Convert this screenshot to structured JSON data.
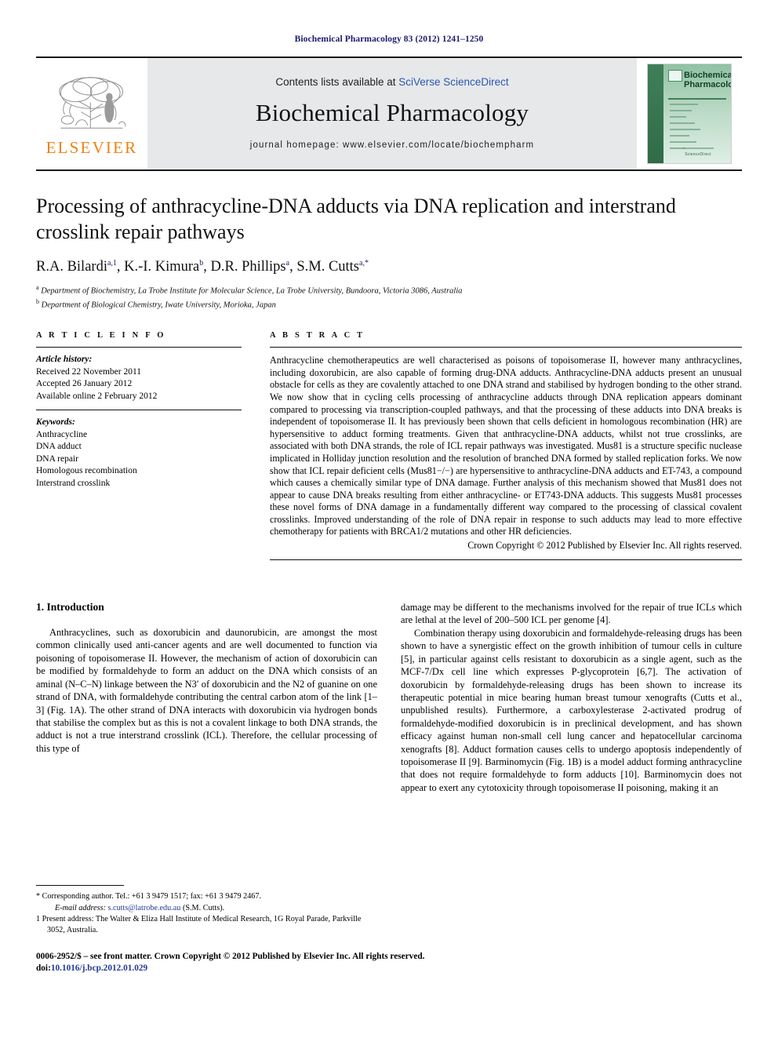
{
  "running_head": "Biochemical Pharmacology 83 (2012) 1241–1250",
  "masthead": {
    "publisher_name": "ELSEVIER",
    "contents_prefix": "Contents lists available at ",
    "contents_link": "SciVerse ScienceDirect",
    "journal_title": "Biochemical Pharmacology",
    "homepage": "journal homepage: www.elsevier.com/locate/biochempharm",
    "cover_title_line1": "Biochemical",
    "cover_title_line2": "Pharmacology",
    "cover_footer": "ScienceDirect"
  },
  "article": {
    "title": "Processing of anthracycline-DNA adducts via DNA replication and interstrand crosslink repair pathways",
    "authors": "R.A. Bilardi a,1, K.-I. Kimura b, D.R. Phillips a, S.M. Cutts a,*",
    "affiliations": [
      "a Department of Biochemistry, La Trobe Institute for Molecular Science, La Trobe University, Bundoora, Victoria 3086, Australia",
      "b Department of Biological Chemistry, Iwate University, Morioka, Japan"
    ]
  },
  "article_info": {
    "heading": "A R T I C L E   I N F O",
    "history_label": "Article history:",
    "history": [
      "Received 22 November 2011",
      "Accepted 26 January 2012",
      "Available online 2 February 2012"
    ],
    "keywords_label": "Keywords:",
    "keywords": [
      "Anthracycline",
      "DNA adduct",
      "DNA repair",
      "Homologous recombination",
      "Interstrand crosslink"
    ]
  },
  "abstract": {
    "heading": "A B S T R A C T",
    "text": "Anthracycline chemotherapeutics are well characterised as poisons of topoisomerase II, however many anthracyclines, including doxorubicin, are also capable of forming drug-DNA adducts. Anthracycline-DNA adducts present an unusual obstacle for cells as they are covalently attached to one DNA strand and stabilised by hydrogen bonding to the other strand. We now show that in cycling cells processing of anthracycline adducts through DNA replication appears dominant compared to processing via transcription-coupled pathways, and that the processing of these adducts into DNA breaks is independent of topoisomerase II. It has previously been shown that cells deficient in homologous recombination (HR) are hypersensitive to adduct forming treatments. Given that anthracycline-DNA adducts, whilst not true crosslinks, are associated with both DNA strands, the role of ICL repair pathways was investigated. Mus81 is a structure specific nuclease implicated in Holliday junction resolution and the resolution of branched DNA formed by stalled replication forks. We now show that ICL repair deficient cells (Mus81−/−) are hypersensitive to anthracycline-DNA adducts and ET-743, a compound which causes a chemically similar type of DNA damage. Further analysis of this mechanism showed that Mus81 does not appear to cause DNA breaks resulting from either anthracycline- or ET743-DNA adducts. This suggests Mus81 processes these novel forms of DNA damage in a fundamentally different way compared to the processing of classical covalent crosslinks. Improved understanding of the role of DNA repair in response to such adducts may lead to more effective chemotherapy for patients with BRCA1/2 mutations and other HR deficiencies.",
    "copyright": "Crown Copyright © 2012 Published by Elsevier Inc. All rights reserved."
  },
  "body": {
    "section_heading": "1. Introduction",
    "left_paragraph": "Anthracyclines, such as doxorubicin and daunorubicin, are amongst the most common clinically used anti-cancer agents and are well documented to function via poisoning of topoisomerase II. However, the mechanism of action of doxorubicin can be modified by formaldehyde to form an adduct on the DNA which consists of an aminal (N–C–N) linkage between the N3′ of doxorubicin and the N2 of guanine on one strand of DNA, with formaldehyde contributing the central carbon atom of the link [1–3] (Fig. 1A). The other strand of DNA interacts with doxorubicin via hydrogen bonds that stabilise the complex but as this is not a covalent linkage to both DNA strands, the adduct is not a true interstrand crosslink (ICL). Therefore, the cellular processing of this type of",
    "right_paragraph_1": "damage may be different to the mechanisms involved for the repair of true ICLs which are lethal at the level of 200–500 ICL per genome [4].",
    "right_paragraph_2": "Combination therapy using doxorubicin and formaldehyde-releasing drugs has been shown to have a synergistic effect on the growth inhibition of tumour cells in culture [5], in particular against cells resistant to doxorubicin as a single agent, such as the MCF-7/Dx cell line which expresses P-glycoprotein [6,7]. The activation of doxorubicin by formaldehyde-releasing drugs has been shown to increase its therapeutic potential in mice bearing human breast tumour xenografts (Cutts et al., unpublished results). Furthermore, a carboxylesterase 2-activated prodrug of formaldehyde-modified doxorubicin is in preclinical development, and has shown efficacy against human non-small cell lung cancer and hepatocellular carcinoma xenografts [8]. Adduct formation causes cells to undergo apoptosis independently of topoisomerase II [9]. Barminomycin (Fig. 1B) is a model adduct forming anthracycline that does not require formaldehyde to form adducts [10]. Barminomycin does not appear to exert any cytotoxicity through topoisomerase II poisoning, making it an"
  },
  "footnotes": {
    "corresponding": "* Corresponding author. Tel.: +61 3 9479 1517; fax: +61 3 9479 2467.",
    "email_label": "E-mail address:",
    "email": "s.cutts@latrobe.edu.au",
    "email_suffix": " (S.M. Cutts).",
    "present_address": "1 Present address: The Walter & Eliza Hall Institute of Medical Research, 1G Royal Parade, Parkville 3052, Australia."
  },
  "imprint": {
    "issn_line": "0006-2952/$ – see front matter. Crown Copyright © 2012 Published by Elsevier Inc. All rights reserved.",
    "doi_label": "doi:",
    "doi": "10.1016/j.bcp.2012.01.029"
  },
  "colors": {
    "link": "#1f3a93",
    "running_head": "#1a1a6e",
    "elsevier_orange": "#f08010",
    "masthead_bg": "#e6e8ea",
    "cover_green": "#3f7f58"
  }
}
